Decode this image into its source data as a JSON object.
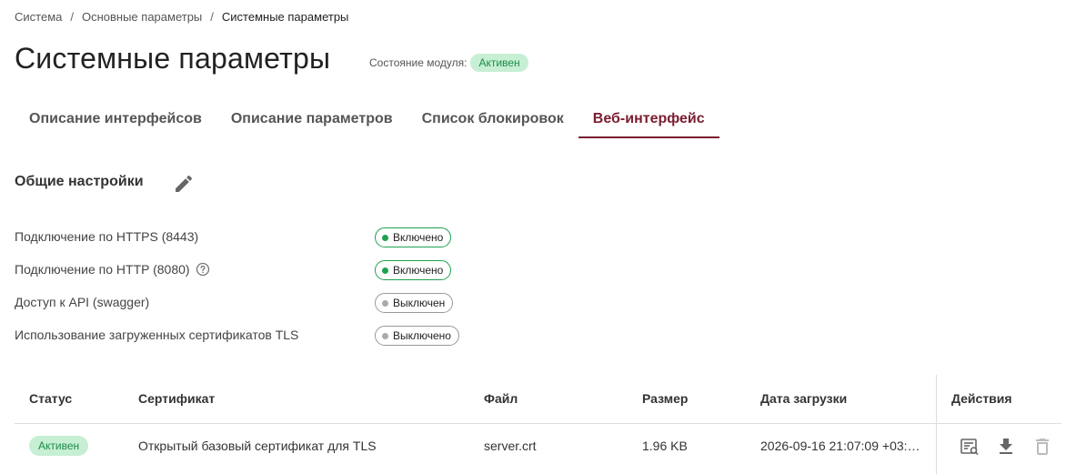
{
  "breadcrumb": {
    "items": [
      "Система",
      "Основные параметры",
      "Системные параметры"
    ],
    "separator": "/"
  },
  "page": {
    "title": "Системные параметры",
    "module_state_label": "Состояние модуля:",
    "module_state_value": "Активен"
  },
  "tabs": [
    {
      "label": "Описание интерфейсов",
      "active": false
    },
    {
      "label": "Описание параметров",
      "active": false
    },
    {
      "label": "Список блокировок",
      "active": false
    },
    {
      "label": "Веб-интерфейс",
      "active": true
    }
  ],
  "general_settings": {
    "title": "Общие настройки",
    "edit_icon": "pencil-icon",
    "rows": [
      {
        "label": "Подключение по HTTPS (8443)",
        "status": "Включено",
        "enabled": true,
        "help": false
      },
      {
        "label": "Подключение по HTTP (8080)",
        "status": "Включено",
        "enabled": true,
        "help": true
      },
      {
        "label": "Доступ к API (swagger)",
        "status": "Выключен",
        "enabled": false,
        "help": false
      },
      {
        "label": "Использование загруженных сертификатов TLS",
        "status": "Выключено",
        "enabled": false,
        "help": false
      }
    ]
  },
  "certificates_table": {
    "columns": [
      "Статус",
      "Сертификат",
      "Файл",
      "Размер",
      "Дата загрузки",
      "Действия"
    ],
    "rows": [
      {
        "status": "Активен",
        "certificate": "Открытый базовый сертификат для TLS",
        "file": "server.crt",
        "size": "1.96 KB",
        "uploaded": "2026-09-16 21:07:09 +03:…",
        "actions": [
          "certificate-view-icon",
          "download-icon",
          "delete-icon"
        ]
      }
    ]
  },
  "colors": {
    "accent": "#7a1d2e",
    "active_green": "#1ea24f",
    "active_bg": "#c6efd4"
  }
}
